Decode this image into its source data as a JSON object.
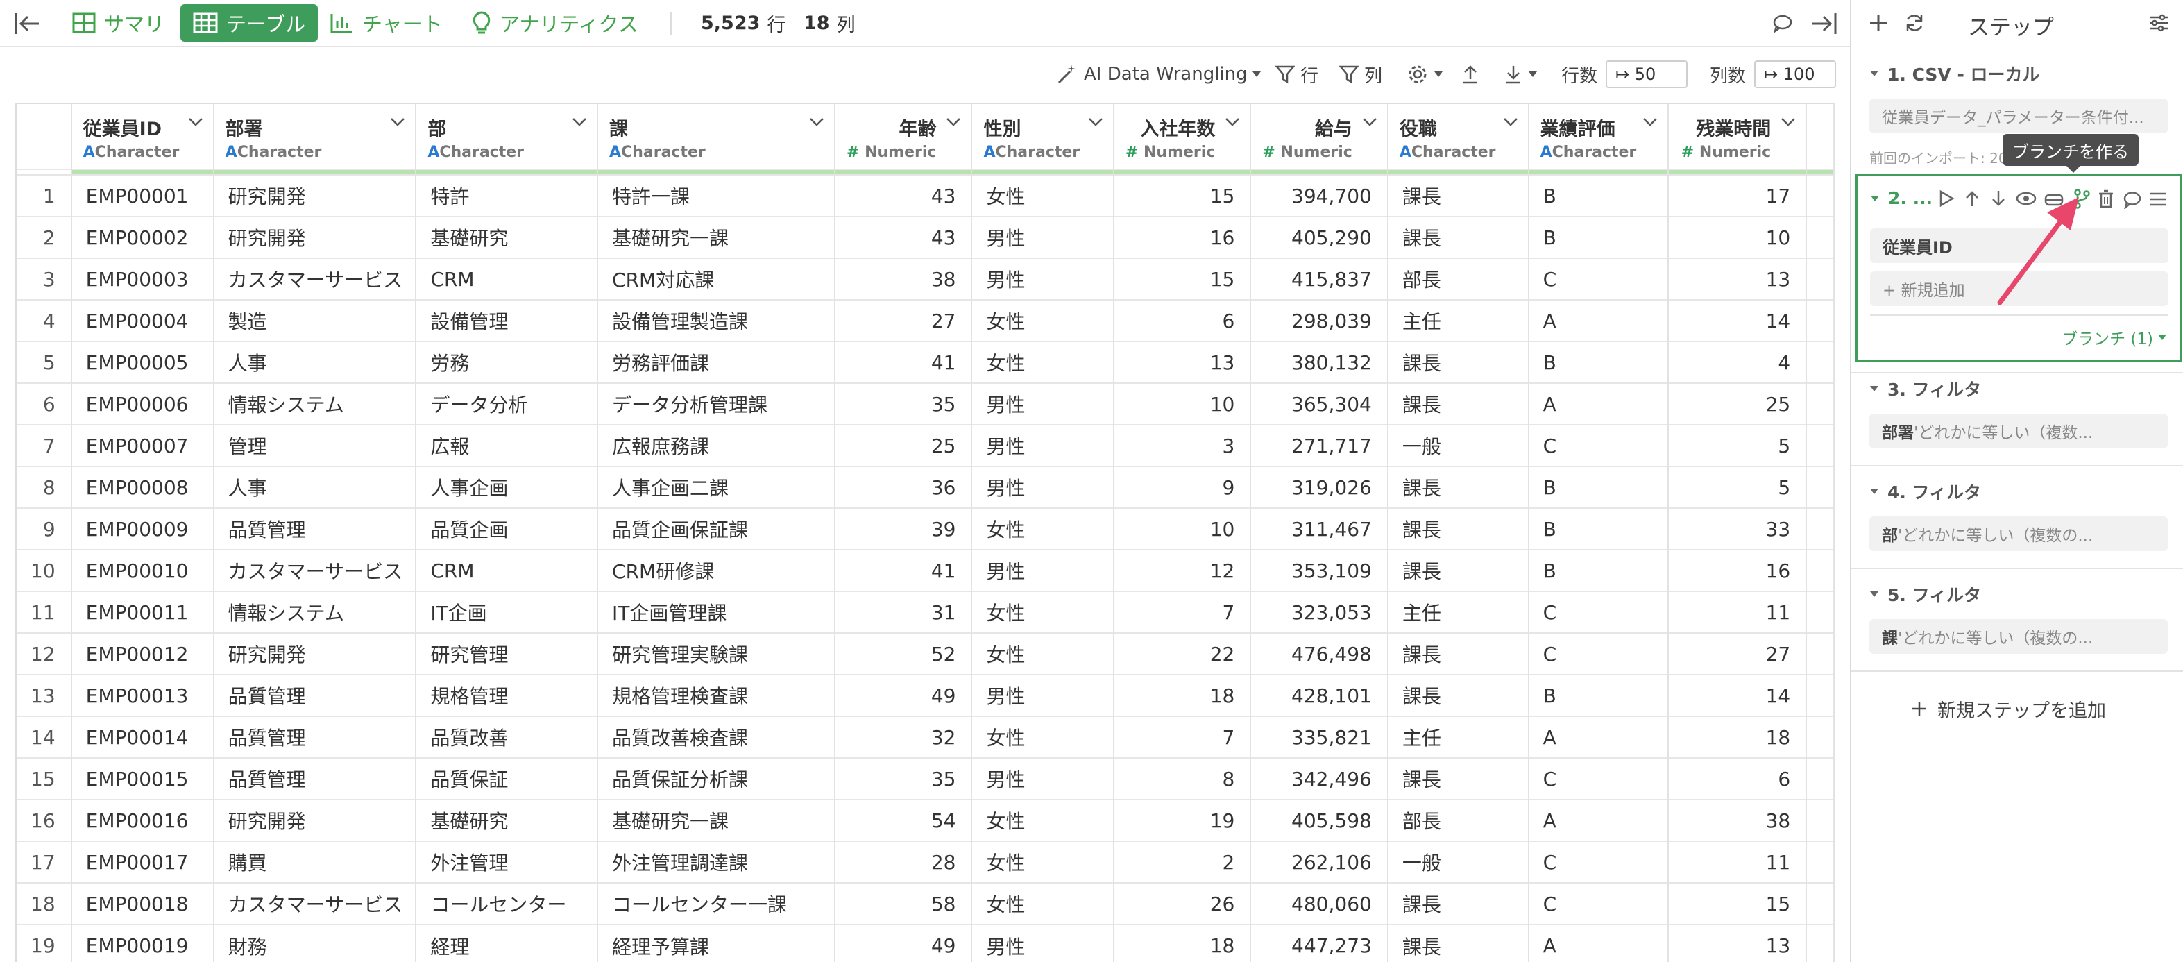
{
  "topbar": {
    "summary_label": "サマリ",
    "table_label": "テーブル",
    "chart_label": "チャート",
    "analytics_label": "アナリティクス",
    "row_count": "5,523",
    "row_unit": "行",
    "col_count": "18",
    "col_unit": "列"
  },
  "toolbar": {
    "ai_label": "AI Data Wrangling",
    "row_filter_label": "行",
    "col_filter_label": "列",
    "rows_label": "行数",
    "rows_value": "↦ 50",
    "cols_label": "列数",
    "cols_value": "↦ 100"
  },
  "table": {
    "columns": [
      {
        "name": "従業員ID",
        "type": "Character"
      },
      {
        "name": "部署",
        "type": "Character"
      },
      {
        "name": "部",
        "type": "Character"
      },
      {
        "name": "課",
        "type": "Character"
      },
      {
        "name": "年齢",
        "type": "Numeric"
      },
      {
        "name": "性別",
        "type": "Character"
      },
      {
        "name": "入社年数",
        "type": "Numeric"
      },
      {
        "name": "給与",
        "type": "Numeric"
      },
      {
        "name": "役職",
        "type": "Character"
      },
      {
        "name": "業績評価",
        "type": "Character"
      },
      {
        "name": "残業時間",
        "type": "Numeric"
      }
    ],
    "rows": [
      [
        "1",
        "EMP00001",
        "研究開発",
        "特許",
        "特許一課",
        "43",
        "女性",
        "15",
        "394,700",
        "課長",
        "B",
        "17"
      ],
      [
        "2",
        "EMP00002",
        "研究開発",
        "基礎研究",
        "基礎研究一課",
        "43",
        "男性",
        "16",
        "405,290",
        "課長",
        "B",
        "10"
      ],
      [
        "3",
        "EMP00003",
        "カスタマーサービス",
        "CRM",
        "CRM対応課",
        "38",
        "男性",
        "15",
        "415,837",
        "部長",
        "C",
        "13"
      ],
      [
        "4",
        "EMP00004",
        "製造",
        "設備管理",
        "設備管理製造課",
        "27",
        "女性",
        "6",
        "298,039",
        "主任",
        "A",
        "14"
      ],
      [
        "5",
        "EMP00005",
        "人事",
        "労務",
        "労務評価課",
        "41",
        "女性",
        "13",
        "380,132",
        "課長",
        "B",
        "4"
      ],
      [
        "6",
        "EMP00006",
        "情報システム",
        "データ分析",
        "データ分析管理課",
        "35",
        "男性",
        "10",
        "365,304",
        "課長",
        "A",
        "25"
      ],
      [
        "7",
        "EMP00007",
        "管理",
        "広報",
        "広報庶務課",
        "25",
        "男性",
        "3",
        "271,717",
        "一般",
        "C",
        "5"
      ],
      [
        "8",
        "EMP00008",
        "人事",
        "人事企画",
        "人事企画二課",
        "36",
        "男性",
        "9",
        "319,026",
        "課長",
        "B",
        "5"
      ],
      [
        "9",
        "EMP00009",
        "品質管理",
        "品質企画",
        "品質企画保証課",
        "39",
        "女性",
        "10",
        "311,467",
        "課長",
        "B",
        "33"
      ],
      [
        "10",
        "EMP00010",
        "カスタマーサービス",
        "CRM",
        "CRM研修課",
        "41",
        "男性",
        "12",
        "353,109",
        "課長",
        "B",
        "16"
      ],
      [
        "11",
        "EMP00011",
        "情報システム",
        "IT企画",
        "IT企画管理課",
        "31",
        "女性",
        "7",
        "323,053",
        "主任",
        "C",
        "11"
      ],
      [
        "12",
        "EMP00012",
        "研究開発",
        "研究管理",
        "研究管理実験課",
        "52",
        "女性",
        "22",
        "476,498",
        "課長",
        "C",
        "27"
      ],
      [
        "13",
        "EMP00013",
        "品質管理",
        "規格管理",
        "規格管理検査課",
        "49",
        "男性",
        "18",
        "428,101",
        "課長",
        "B",
        "14"
      ],
      [
        "14",
        "EMP00014",
        "品質管理",
        "品質改善",
        "品質改善検査課",
        "32",
        "女性",
        "7",
        "335,821",
        "主任",
        "A",
        "18"
      ],
      [
        "15",
        "EMP00015",
        "品質管理",
        "品質保証",
        "品質保証分析課",
        "35",
        "男性",
        "8",
        "342,496",
        "課長",
        "C",
        "6"
      ],
      [
        "16",
        "EMP00016",
        "研究開発",
        "基礎研究",
        "基礎研究一課",
        "54",
        "女性",
        "19",
        "405,598",
        "部長",
        "A",
        "38"
      ],
      [
        "17",
        "EMP00017",
        "購買",
        "外注管理",
        "外注管理調達課",
        "28",
        "女性",
        "2",
        "262,106",
        "一般",
        "C",
        "11"
      ],
      [
        "18",
        "EMP00018",
        "カスタマーサービス",
        "コールセンター",
        "コールセンター一課",
        "58",
        "女性",
        "26",
        "480,060",
        "課長",
        "C",
        "15"
      ],
      [
        "19",
        "EMP00019",
        "財務",
        "経理",
        "経理予算課",
        "49",
        "男性",
        "18",
        "447,273",
        "課長",
        "A",
        "13"
      ]
    ]
  },
  "steps": {
    "title": "ステップ",
    "step1": {
      "title": "1. CSV - ローカル",
      "box": "従業員データ_パラメーター条件付...",
      "note": "前回のインポート: 20"
    },
    "step2": {
      "title": "2. ...",
      "field": "従業員ID",
      "add_label": "+ 新規追加",
      "branch_label": "ブランチ (1)"
    },
    "tooltip": "ブランチを作る",
    "step3": {
      "title": "3. フィルタ",
      "key": "部署",
      "desc": " 'どれかに等しい（複数..."
    },
    "step4": {
      "title": "4. フィルタ",
      "key": "部",
      "desc": " 'どれかに等しい（複数の..."
    },
    "step5": {
      "title": "5. フィルタ",
      "key": "課",
      "desc": " 'どれかに等しい（複数の..."
    },
    "add_step_label": "新規ステップを追加"
  }
}
